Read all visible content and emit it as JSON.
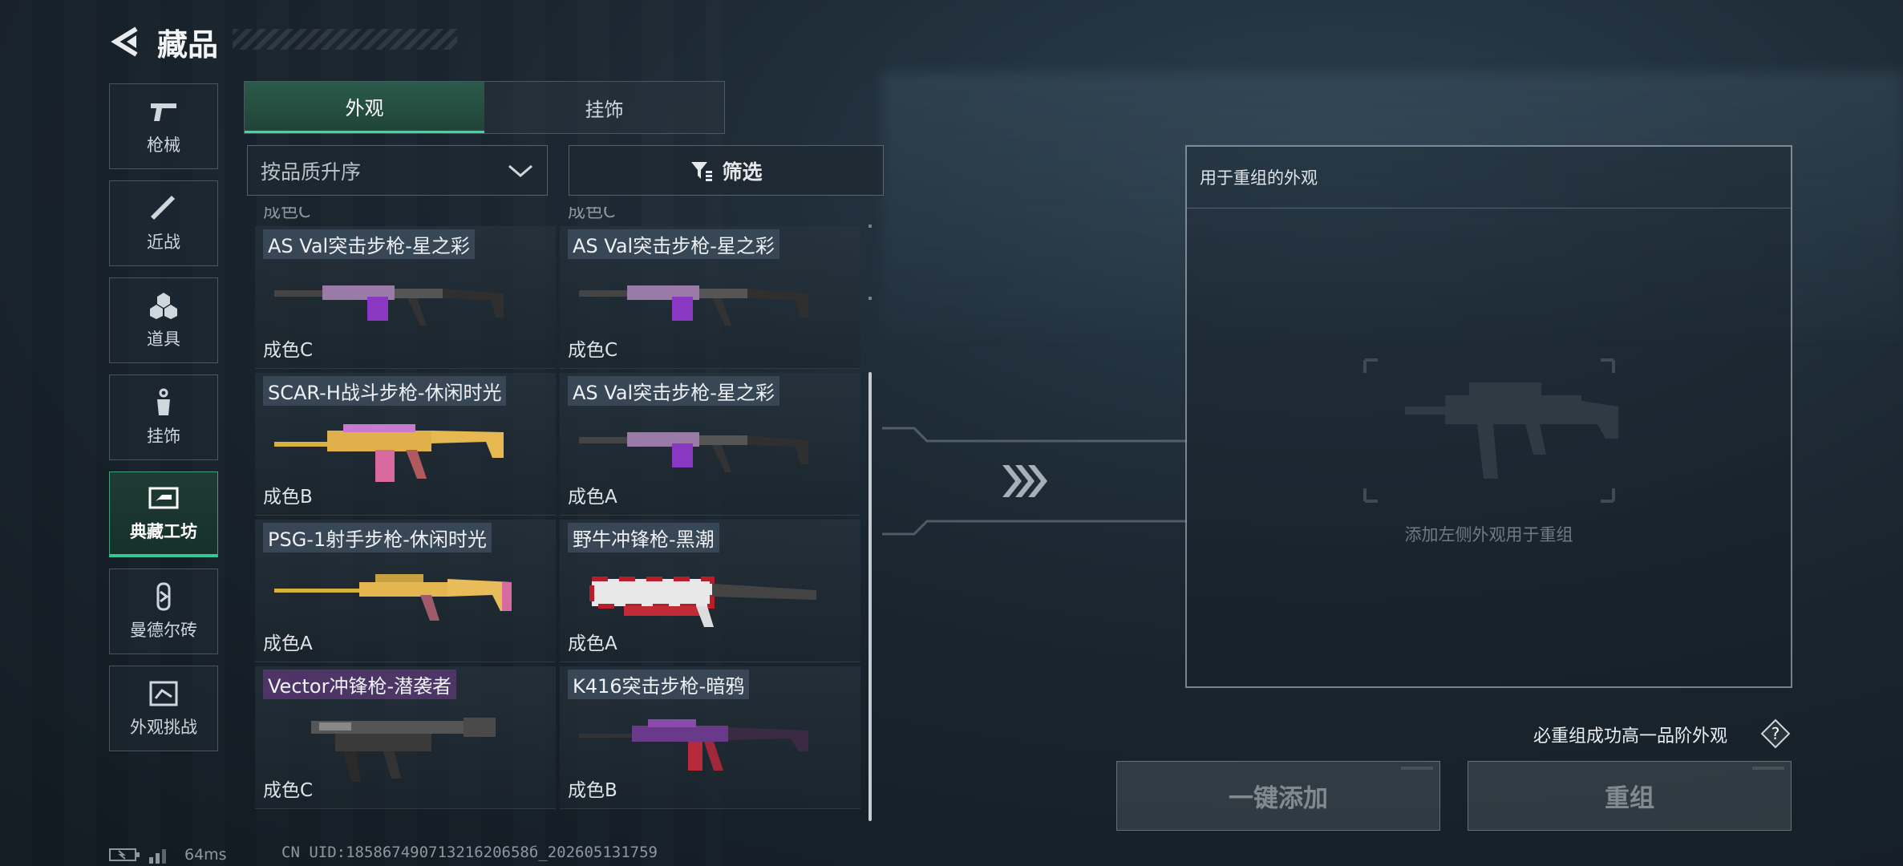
{
  "header": {
    "title": "藏品",
    "back_icon": "back-arrow-icon"
  },
  "sidebar": {
    "items": [
      {
        "label": "枪械",
        "icon": "pistol-icon"
      },
      {
        "label": "近战",
        "icon": "knife-icon"
      },
      {
        "label": "道具",
        "icon": "grenade-icon"
      },
      {
        "label": "挂饰",
        "icon": "charm-icon"
      },
      {
        "label": "典藏工坊",
        "icon": "workshop-icon",
        "active": true
      },
      {
        "label": "曼德尔砖",
        "icon": "mandel-brick-icon"
      },
      {
        "label": "外观挑战",
        "icon": "challenge-icon"
      }
    ]
  },
  "tabs": [
    {
      "label": "外观",
      "active": true
    },
    {
      "label": "挂饰",
      "active": false
    }
  ],
  "sort": {
    "value": "按品质升序"
  },
  "filter": {
    "label": "筛选"
  },
  "list": {
    "clipped_top": [
      "成色C",
      "成色C"
    ],
    "items": [
      {
        "name": "AS Val突击步枪-星之彩",
        "quality": "成色C",
        "highlight": "blue"
      },
      {
        "name": "AS Val突击步枪-星之彩",
        "quality": "成色C",
        "highlight": "blue"
      },
      {
        "name": "SCAR-H战斗步枪-休闲时光",
        "quality": "成色B",
        "highlight": "blue"
      },
      {
        "name": "AS Val突击步枪-星之彩",
        "quality": "成色A",
        "highlight": "blue"
      },
      {
        "name": "PSG-1射手步枪-休闲时光",
        "quality": "成色A",
        "highlight": "blue"
      },
      {
        "name": "野牛冲锋枪-黑潮",
        "quality": "成色A",
        "highlight": "blue"
      },
      {
        "name": "Vector冲锋枪-潜袭者",
        "quality": "成色C",
        "highlight": "purple"
      },
      {
        "name": "K416突击步枪-暗鸦",
        "quality": "成色B",
        "highlight": "blue"
      }
    ]
  },
  "panel": {
    "title": "用于重组的外观",
    "hint": "添加左侧外观用于重组"
  },
  "note": "必重组成功高一品阶外观",
  "buttons": {
    "add_all": "一键添加",
    "recombine": "重组"
  },
  "status": {
    "ping": "64ms",
    "uid": "CN UID:18586749071321620658б_202605131759"
  }
}
